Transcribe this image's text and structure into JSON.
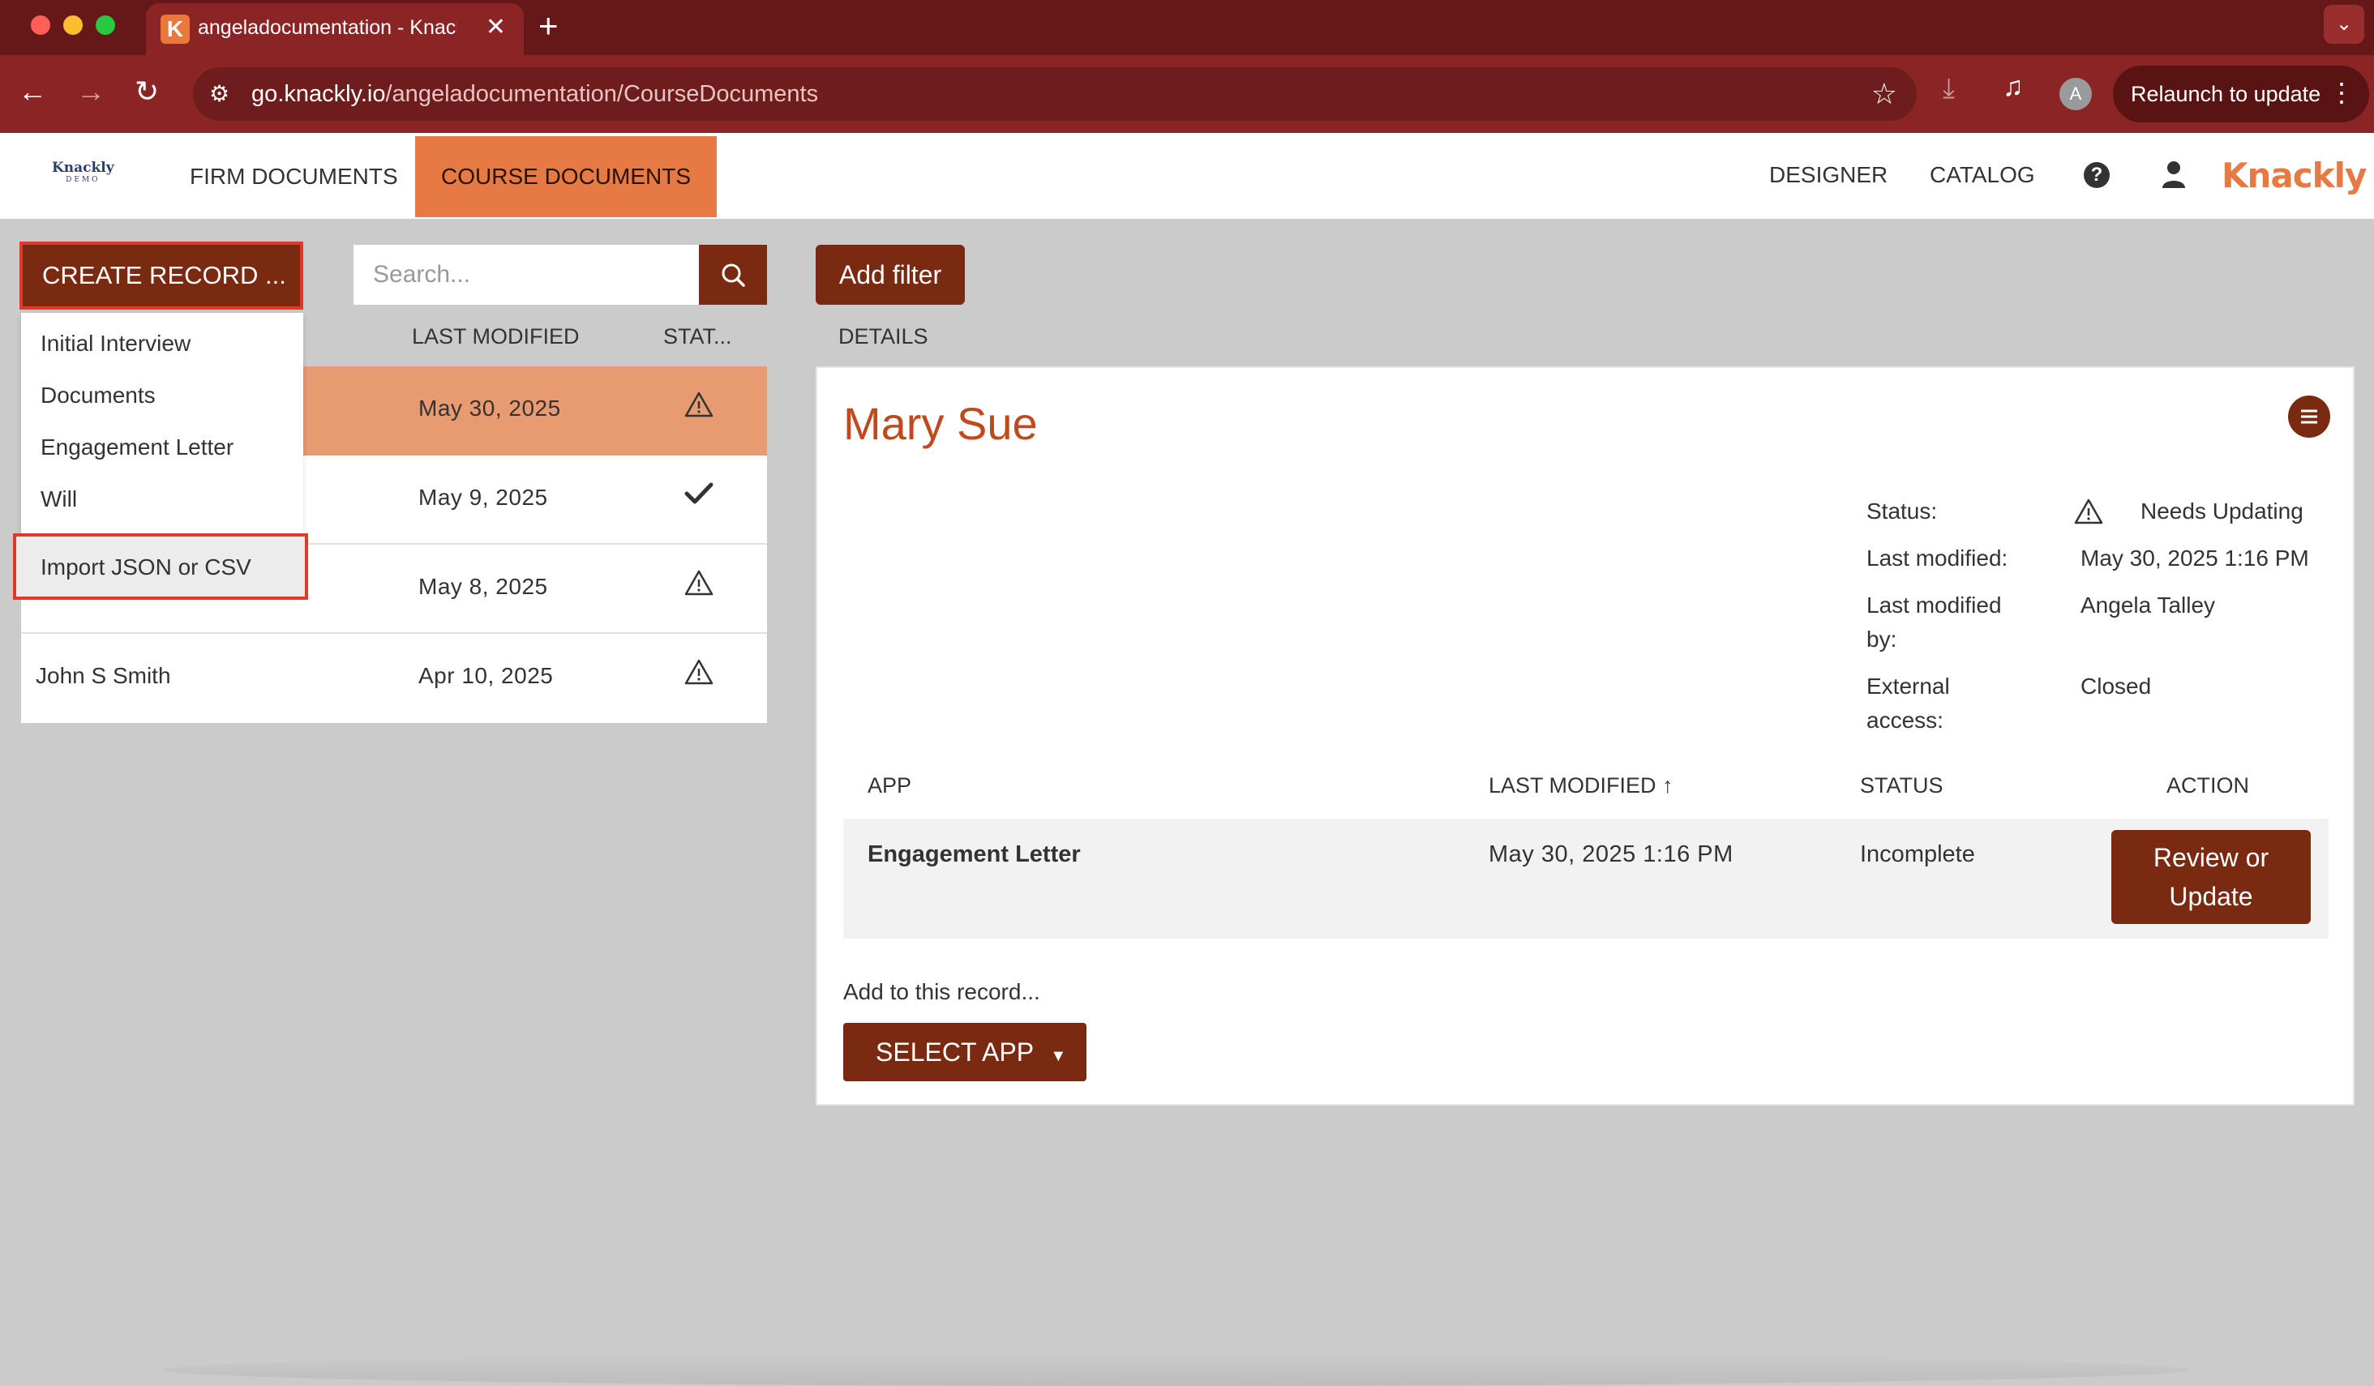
{
  "browser": {
    "tab_title": "angeladocumentation - Knackly",
    "tab_favicon": "K",
    "url_domain": "go.knackly.io",
    "url_path": "/angeladocumentation/CourseDocuments",
    "avatar_letter": "A",
    "relaunch_label": "Relaunch to update",
    "theme_color": "#8b2424"
  },
  "header": {
    "small_logo": "Knackly",
    "small_logo_sub": "DEMO",
    "nav": [
      "FIRM DOCUMENTS",
      "COURSE DOCUMENTS"
    ],
    "active_nav": "COURSE DOCUMENTS",
    "right_nav": [
      "DESIGNER",
      "CATALOG"
    ],
    "brand": "Knackly",
    "accent_color": "#e57a45",
    "button_color": "#7a2a10"
  },
  "toolbar": {
    "create_label": "CREATE RECORD  ...",
    "search_placeholder": "Search...",
    "filter_label": "Add filter"
  },
  "records": {
    "columns": [
      "LAST MODIFIED",
      "STAT..."
    ],
    "rows": [
      {
        "name": "",
        "date": "May 30, 2025",
        "status_icon": "warning-icon",
        "selected": true
      },
      {
        "name": "",
        "date": "May 9, 2025",
        "status_icon": "check-icon",
        "selected": false
      },
      {
        "name": "",
        "date": "May 8, 2025",
        "status_icon": "warning-icon",
        "selected": false
      },
      {
        "name": "John S Smith",
        "date": "Apr 10, 2025",
        "status_icon": "warning-icon",
        "selected": false
      }
    ]
  },
  "dropdown": {
    "items": [
      "Initial Interview",
      "Documents",
      "Engagement Letter",
      "Will"
    ],
    "import_label": "Import JSON or CSV"
  },
  "details": {
    "heading": "DETAILS",
    "title": "Mary Sue",
    "status_label": "Status:",
    "status_value": "Needs Updating",
    "last_modified_label": "Last modified:",
    "last_modified_value": "May 30, 2025 1:16 PM",
    "last_modified_by_label": "Last modified by:",
    "last_modified_by_value": "Angela Talley",
    "external_access_label": "External access:",
    "external_access_value": "Closed",
    "table": {
      "headers": [
        "APP",
        "LAST MODIFIED",
        "STATUS",
        "ACTION"
      ],
      "row": {
        "app": "Engagement Letter",
        "modified": "May 30, 2025 1:16 PM",
        "status": "Incomplete",
        "action": "Review or Update"
      }
    },
    "add_label": "Add to this record...",
    "select_app_label": "SELECT APP"
  }
}
